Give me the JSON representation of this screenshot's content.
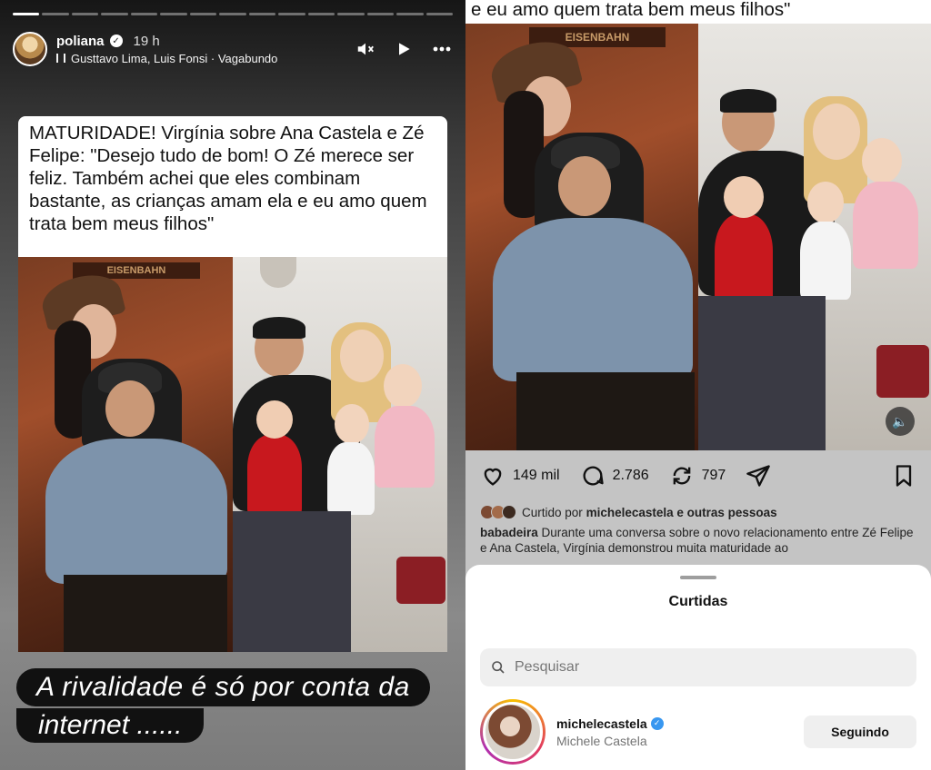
{
  "story": {
    "progress_total": 15,
    "progress_done": 1,
    "username": "poliana",
    "time": "19 h",
    "music": "Gusttavo Lima, Luis Fonsi · Vagabundo",
    "icons": [
      "mute-icon",
      "play-icon",
      "more-icon"
    ],
    "caption": "MATURIDADE! Virgínia sobre Ana Castela e Zé Felipe: \"Desejo tudo de bom! O Zé merece ser feliz. Também achei que eles combinam bastante, as crianças amam ela e eu amo quem trata bem meus filhos\"",
    "photo_sign": "EISENBAHN",
    "overlay_line1": "A rivalidade é só por conta da",
    "overlay_line2": "internet ......"
  },
  "post": {
    "caption_top": "e eu amo quem trata bem meus filhos\"",
    "photo_sign": "EISENBAHN",
    "likes": "149 mil",
    "comments": "2.786",
    "reposts": "797",
    "liked_by_prefix": "Curtido por",
    "liked_by_user": "michelecastela",
    "liked_by_suffix": "e outras pessoas",
    "caption_user": "babadeira",
    "caption_text": "Durante uma conversa sobre o novo relacionamento entre Zé Felipe e Ana Castela, Virgínia demonstrou muita maturidade ao"
  },
  "sheet": {
    "title": "Curtidas",
    "search_placeholder": "Pesquisar",
    "users": [
      {
        "username": "michelecastela",
        "full_name": "Michele Castela",
        "button": "Seguindo",
        "verified": true
      }
    ]
  }
}
